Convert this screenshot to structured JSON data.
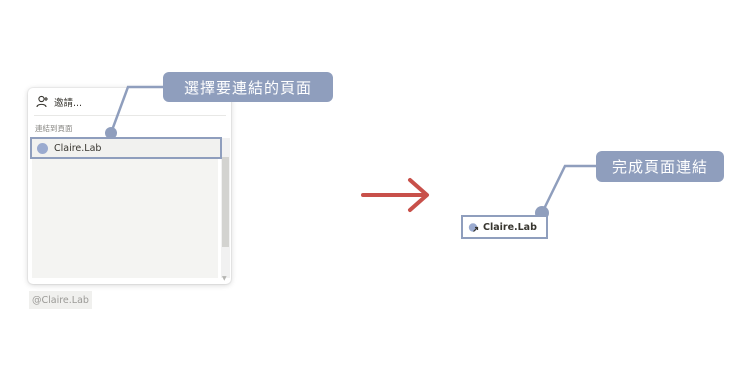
{
  "popup": {
    "invite_label": "邀請...",
    "section_label": "連結到頁面",
    "page_item_name": "Claire.Lab"
  },
  "mention": {
    "text": "@Claire.Lab"
  },
  "callouts": {
    "select_page": "選擇要連結的頁面",
    "done": "完成頁面連結"
  },
  "result": {
    "name": "Claire.Lab"
  },
  "icons": {
    "invite": "add-person-icon",
    "page": "page-dot-icon",
    "linked_page": "linked-page-icon",
    "arrow": "right-arrow-icon"
  },
  "colors": {
    "accent": "#8f9ebd",
    "arrow": "#c8504a"
  }
}
